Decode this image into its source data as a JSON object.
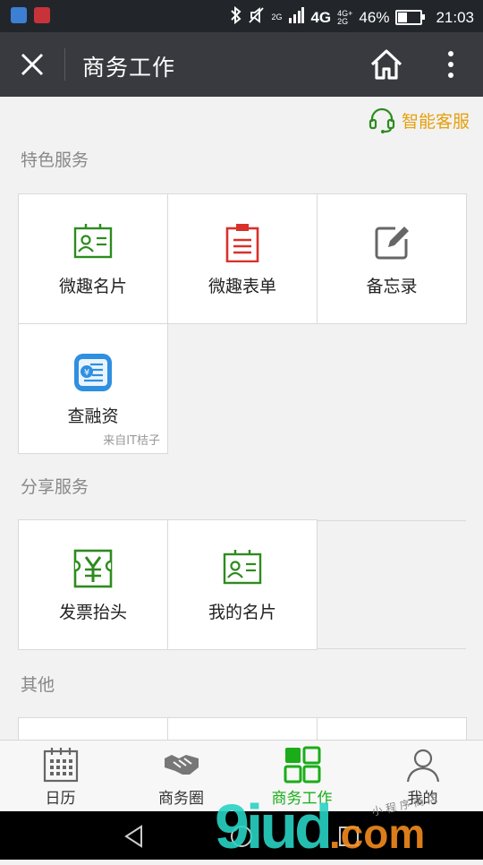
{
  "status_bar": {
    "network_primary": "4G",
    "network_secondary_top": "4G+",
    "network_secondary_bottom": "2G",
    "network_small": "2G",
    "battery_percent": "46%",
    "battery_level": 0.46,
    "time": "21:03"
  },
  "title_bar": {
    "title": "商务工作"
  },
  "assistant": {
    "label": "智能客服",
    "color": "#e5a00d"
  },
  "sections": {
    "featured": {
      "title": "特色服务",
      "items": [
        {
          "label": "微趣名片",
          "icon": "business-card-icon"
        },
        {
          "label": "微趣表单",
          "icon": "clipboard-form-icon"
        },
        {
          "label": "备忘录",
          "icon": "edit-note-icon"
        },
        {
          "label": "查融资",
          "icon": "finance-search-icon",
          "source": "来自IT桔子"
        }
      ]
    },
    "share": {
      "title": "分享服务",
      "items": [
        {
          "label": "发票抬头",
          "icon": "invoice-yen-icon"
        },
        {
          "label": "我的名片",
          "icon": "business-card-icon"
        }
      ]
    },
    "other": {
      "title": "其他"
    }
  },
  "tabs": [
    {
      "label": "日历",
      "icon": "calendar-icon",
      "active": false
    },
    {
      "label": "商务圈",
      "icon": "handshake-icon",
      "active": false
    },
    {
      "label": "商务工作",
      "icon": "grid-apps-icon",
      "active": true
    },
    {
      "label": "我的",
      "icon": "person-icon",
      "active": false
    }
  ],
  "watermark": {
    "main": "9iud",
    "suffix": ".com",
    "tagline": "小 程 序 商 店"
  },
  "colors": {
    "accent_green": "#1aad19",
    "titlebar_bg": "#393a3f",
    "icon_red": "#d9302b",
    "icon_green": "#2e8b1e",
    "icon_blue": "#2f8fe0"
  }
}
